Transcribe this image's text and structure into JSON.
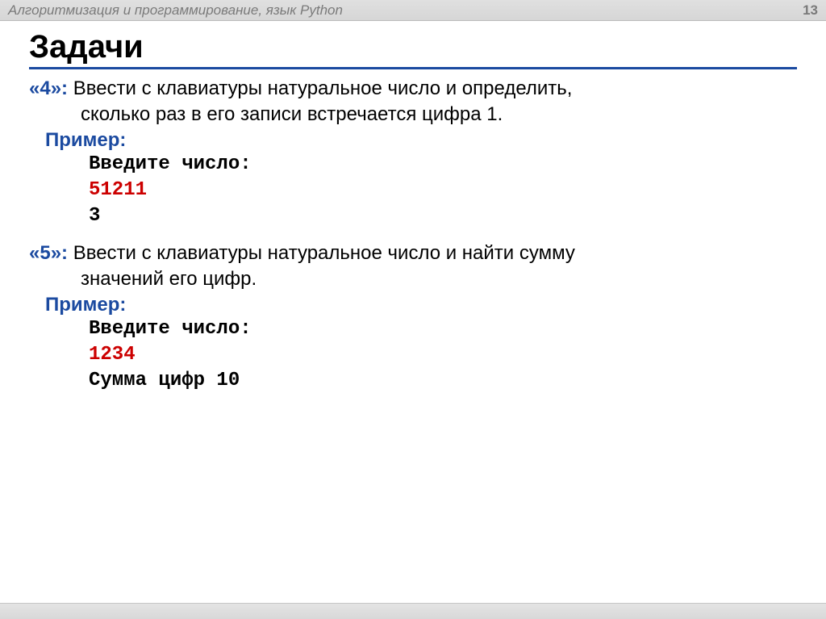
{
  "header": {
    "title": "Алгоритмизация и программирование, язык Python",
    "page": "13"
  },
  "heading": "Задачи",
  "task4": {
    "label": "«4»:",
    "text1": " Ввести с клавиатуры натуральное число и определить,",
    "text2": "сколько  раз в его записи встречается цифра 1.",
    "primer": "Пример:",
    "code1": "Введите число:",
    "code2": "51211",
    "code3": "3"
  },
  "task5": {
    "label": "«5»:",
    "text1": " Ввести с клавиатуры натуральное число и найти сумму",
    "text2": "значений его цифр.",
    "primer": "Пример:",
    "code1": "Введите число:",
    "code2": "1234",
    "code3": "Сумма цифр 10"
  }
}
